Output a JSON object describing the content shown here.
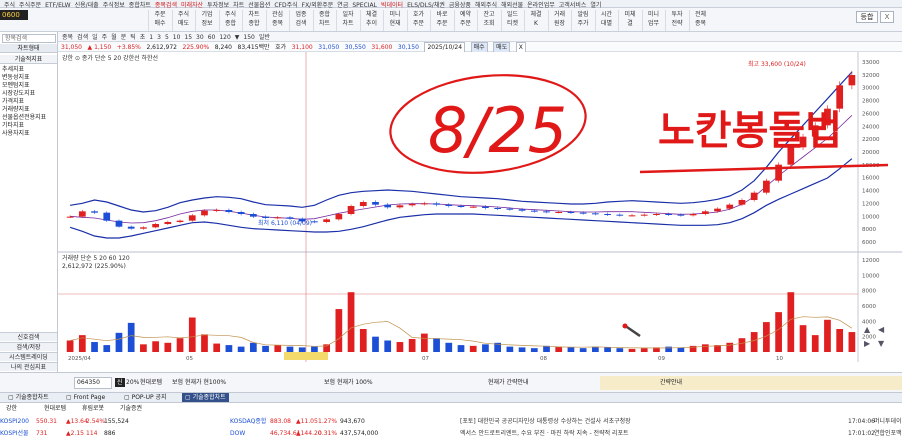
{
  "menu": [
    "주식",
    "주식주문",
    "ETF/ELW",
    "신용/대출",
    "주식정보",
    "종합차트",
    "종목검색",
    "미래자산",
    "투자정보",
    "차트",
    "선물옵션",
    "CFD주식",
    "FX/외환주문",
    "연금",
    "SPECIAL",
    "빅데이터",
    "ELS/DLS/채권",
    "금융상품",
    "해외주식",
    "해외선물",
    "온라인업무",
    "고객서비스",
    "열기"
  ],
  "menu_red_indices": [
    6,
    7,
    15
  ],
  "top_buttons": [
    "주문\n매수",
    "주식\n매도",
    "기업\n정보",
    "주식\n종합",
    "차트\n종합",
    "관심\n종목",
    "업종\n검색",
    "종합\n차트",
    "일자\n차트",
    "체결\n추이",
    "미니\n현재",
    "호가\n주문",
    "바로\n주문",
    "예약\n주문",
    "잔고\n조회",
    "일드\n티켓",
    "체결\nK",
    "거래\n원장",
    "알림\n주가",
    "시간\n대별",
    "미체\n결",
    "미니\n업무",
    "투자\n전략",
    "전체\n종목"
  ],
  "code": "0600",
  "top_right_buttons": [
    "등합",
    "X"
  ],
  "search_placeholder": "항목검색",
  "chart_toolbar": [
    "종목",
    "검색",
    "일",
    "주",
    "월",
    "분",
    "틱",
    "초",
    "1",
    "3",
    "5",
    "10",
    "15",
    "30",
    "60",
    "120",
    "▼",
    "150",
    "일반"
  ],
  "price_bar": {
    "price": "31,050",
    "change": "▲ 1,150",
    "pct": "+3.85%",
    "volume": "2,612,972",
    "ratio": "225.90%",
    "open_label": "8,240",
    "turnover": "83,415백만",
    "hoga": "호가",
    "high": "31,100",
    "low": "31,050",
    "mid1": "30,550",
    "mid2": "31,600",
    "mid3": "30,150",
    "date": "2025/10/24",
    "btn_buy": "매수",
    "btn_sell": "매도",
    "btn_x": "X"
  },
  "left_panel": {
    "header1": "차트형태",
    "header2": "기술적지표",
    "items": [
      "추세지표",
      "변동성지표",
      "모멘텀지표",
      "시장강도지표",
      "가격지표",
      "거래량지표",
      "선물옵션전용지표",
      "기타지표",
      "사용자지표"
    ],
    "bottom": [
      "신호검색",
      "검색/저장",
      "시스템트레이딩",
      "나의 관심지표"
    ]
  },
  "chart": {
    "legend": "강한 ⊙ 종가 단순 5 20 강한선 하한선",
    "high_label": "최고 33,600 (10/24)",
    "low_label": "최저 6,110 (04/09)",
    "volume_legend": "거래량 단순 5 20 60 120",
    "volume_value": "2,612,972 (225.90%)",
    "price_ticks": [
      "33000",
      "32000",
      "30000",
      "28000",
      "26000",
      "24000",
      "22000",
      "20000",
      "18000",
      "16000",
      "14000",
      "12000",
      "10000",
      "8000",
      "6000"
    ],
    "volume_ticks": [
      "12000",
      "10000",
      "8000",
      "6000",
      "4000",
      "2000"
    ],
    "x_labels": [
      "2025/04",
      "05",
      "06",
      "07",
      "08",
      "09",
      "10"
    ],
    "annotation_date": "8/25",
    "annotation_text": "노칸봉돌법",
    "bollinger_upper": [
      11500,
      11800,
      12300,
      12000,
      11400,
      10800,
      10500,
      10700,
      11200,
      11900,
      12300,
      12600,
      12800,
      12700,
      12500,
      12000,
      11600,
      11500,
      11400,
      11200,
      11500,
      12300,
      13000,
      13400,
      13600,
      13700,
      13800,
      13700,
      13600,
      13400,
      13200,
      13000,
      12800,
      12700,
      12600,
      12500,
      12300,
      12100,
      12000,
      11900,
      11800,
      11700,
      11700,
      11800,
      12000,
      12100,
      12200,
      12100,
      12000,
      11900,
      11800,
      11900,
      12100,
      12400,
      12900,
      13800,
      15200,
      17200,
      19500,
      21500,
      23500,
      25500,
      27500,
      29500,
      31500
    ],
    "bollinger_lower": [
      8200,
      7600,
      6900,
      6600,
      6600,
      6900,
      7300,
      7700,
      8100,
      8500,
      8900,
      9000,
      8800,
      8500,
      8200,
      8000,
      7900,
      7800,
      7700,
      7600,
      7500,
      7500,
      7600,
      7900,
      8300,
      8800,
      9300,
      9700,
      9900,
      10100,
      10200,
      10200,
      10200,
      10200,
      10100,
      10000,
      9900,
      9800,
      9700,
      9600,
      9500,
      9400,
      9300,
      9200,
      9100,
      9000,
      8900,
      8800,
      8700,
      8600,
      8500,
      8500,
      8500,
      8600,
      8900,
      9500,
      10400,
      11500,
      12400,
      13200,
      14000,
      14800,
      15600,
      17000,
      18500
    ],
    "close": [
      9800,
      10600,
      10400,
      9200,
      8300,
      8000,
      8200,
      8700,
      9000,
      9200,
      10000,
      10700,
      10800,
      10500,
      10200,
      9800,
      9600,
      9700,
      9500,
      9100,
      9000,
      9400,
      10200,
      11400,
      12000,
      11600,
      11200,
      11500,
      11700,
      11800,
      11600,
      11400,
      11300,
      11300,
      11100,
      11000,
      10900,
      10700,
      10600,
      10500,
      10500,
      10400,
      10300,
      10200,
      10100,
      10000,
      10000,
      10100,
      10200,
      10100,
      10000,
      10200,
      10600,
      11000,
      11600,
      12300,
      13400,
      15200,
      17600,
      20200,
      21800,
      23500,
      26000,
      29500,
      31050
    ],
    "volume": [
      1500,
      2200,
      1300,
      900,
      2500,
      3800,
      1000,
      1400,
      1200,
      1800,
      4500,
      2300,
      1100,
      900,
      700,
      1200,
      800,
      900,
      700,
      600,
      700,
      1000,
      5600,
      7800,
      3000,
      2000,
      1500,
      1300,
      1700,
      2400,
      1800,
      1200,
      900,
      800,
      1000,
      1200,
      700,
      600,
      500,
      800,
      700,
      600,
      500,
      700,
      600,
      500,
      400,
      500,
      600,
      700,
      600,
      800,
      1000,
      900,
      1200,
      1800,
      2600,
      3900,
      5200,
      7800,
      3500,
      2200,
      4200,
      3000,
      2600
    ]
  },
  "bottom_bar": {
    "code": "064350",
    "badge": "신",
    "zoom": "20%",
    "name": "현대로템",
    "info1": "보험  현재가  현100%",
    "info2": "보험  현재가  100%",
    "info3": "현재가  간략안내",
    "info4": "간략안내"
  },
  "taskbar": [
    "기술종합차트",
    "Front Page",
    "POP-UP 공지",
    "기술종합차트"
  ],
  "ticker_rows": [
    [
      "KOSPI200",
      "550.31",
      "▲13.64",
      "2.54%",
      "155,524",
      "KOSDAQ종합",
      "883.08",
      "▲11.05",
      "1.27%",
      "943,670",
      "[포토] 대한민국 공공디자인상 대통령상 수상하는 건설사 서초구청장",
      "17:04:06",
      "머니투데이"
    ],
    [
      "KOSPI선물",
      "731",
      "▲2.15",
      "114",
      "886",
      "DOW",
      "46,734.61",
      "▲144.20",
      "0.31%",
      "437,574,000",
      "엑서스 안드로트리엔트, 수요 부진 · 마진 하락 지속 - 전략적 리포트",
      "17:01:02",
      "연합인포맥스"
    ]
  ],
  "sub_tabs": [
    "강한",
    "현대로템",
    "휴림로봇",
    "기술증권"
  ],
  "colors": {
    "up": "#e02020",
    "down": "#1d4fd6",
    "ink": "#e01818",
    "band": "#1a2fa8",
    "ma": "#7a2aa0"
  }
}
